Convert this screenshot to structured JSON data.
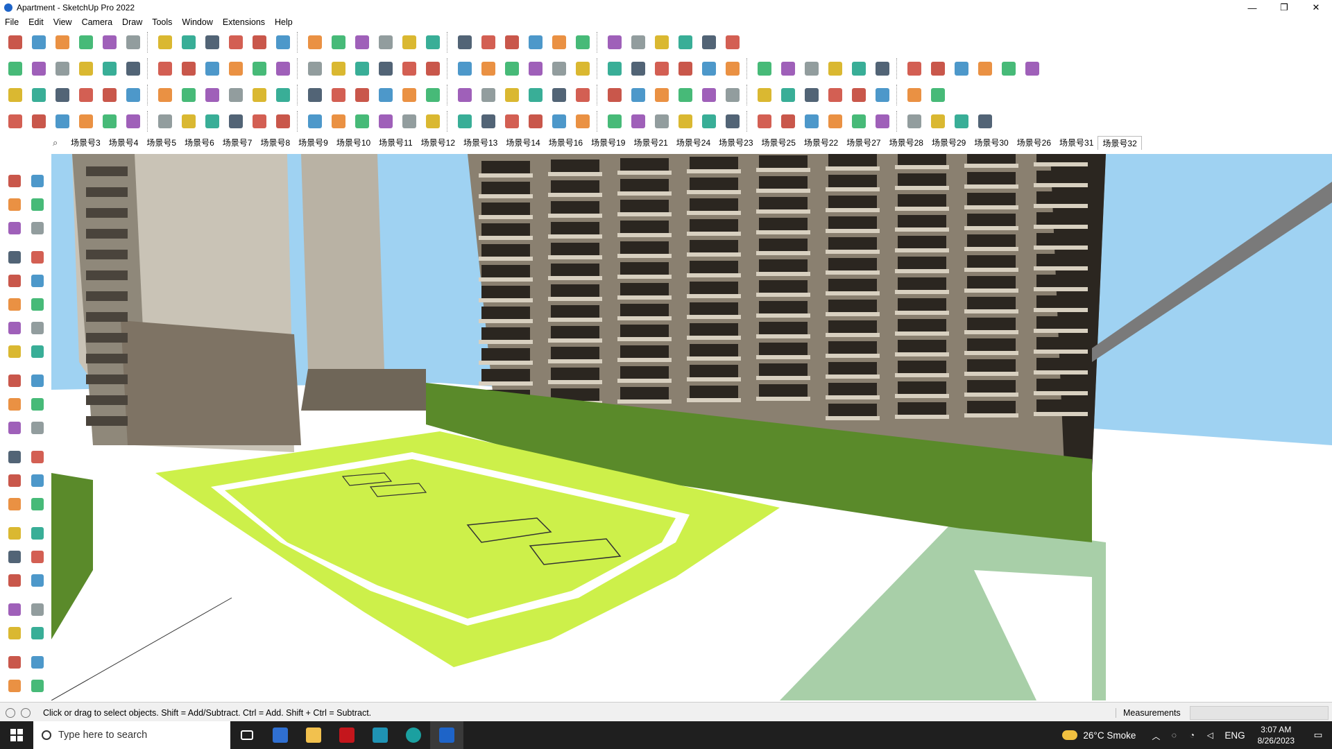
{
  "window": {
    "title": "Apartment - SketchUp Pro 2022",
    "minimize": "—",
    "maximize": "❐",
    "close": "✕"
  },
  "menu": [
    "File",
    "Edit",
    "View",
    "Camera",
    "Draw",
    "Tools",
    "Window",
    "Extensions",
    "Help"
  ],
  "scenes": {
    "search_icon": "⌕",
    "tabs": [
      "场景号3",
      "场景号4",
      "场景号5",
      "场景号6",
      "场景号7",
      "场景号8",
      "场景号9",
      "场景号10",
      "场景号11",
      "场景号12",
      "场景号13",
      "场景号14",
      "场景号16",
      "场景号19",
      "场景号21",
      "场景号24",
      "场景号23",
      "场景号25",
      "场景号22",
      "场景号27",
      "场景号28",
      "场景号29",
      "场景号30",
      "场景号26",
      "场景号31",
      "场景号32"
    ],
    "active": "场景号32"
  },
  "status": {
    "hint": "Click or drag to select objects. Shift = Add/Subtract. Ctrl = Add. Shift + Ctrl = Subtract.",
    "measurements_label": "Measurements",
    "measurements_value": ""
  },
  "taskbar": {
    "search_placeholder": "Type here to search",
    "weather": "26°C  Smoke",
    "language": "ENG",
    "time": "3:07 AM",
    "date": "8/26/2023",
    "apps": [
      "task-view-icon",
      "calculator-icon",
      "file-explorer-icon",
      "acrobat-icon",
      "teams-icon",
      "edge-icon",
      "sketchup-icon"
    ]
  },
  "colors": {
    "sky": "#9fd2f2",
    "lawn": "#cdf04a",
    "hedge": "#5a8a2a",
    "building": "#8a8070",
    "building_dark": "#2b2620",
    "paving": "#ffffff",
    "ground_green": "#a8cfa8"
  }
}
